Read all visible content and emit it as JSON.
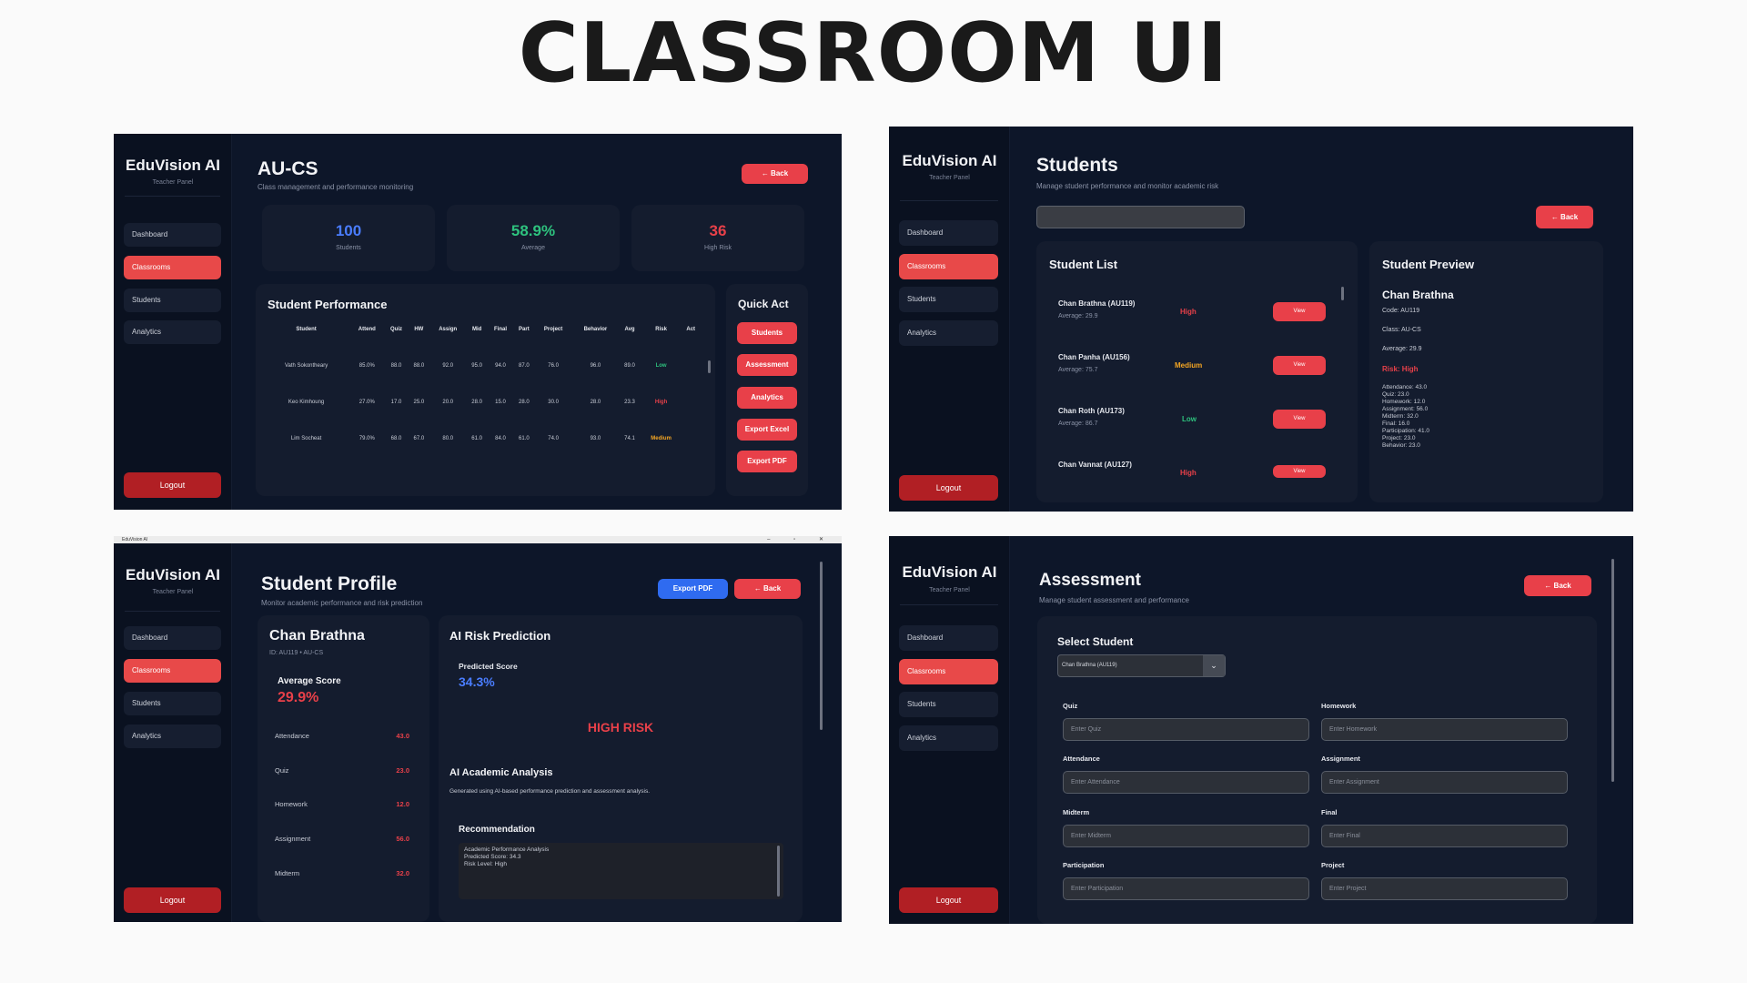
{
  "page_title": "CLASSROOM UI",
  "brand": "EduVision AI",
  "brand_sub": "Teacher Panel",
  "nav": [
    "Dashboard",
    "Classrooms",
    "Students",
    "Analytics"
  ],
  "logout": "Logout",
  "back": "← Back",
  "colors": {
    "accent": "#e84949",
    "green": "#2ec27e",
    "orange": "#f5a623",
    "blue": "#4a7dff",
    "risk_red": "#e84049"
  },
  "s1": {
    "title": "AU-CS",
    "subtitle": "Class management and performance monitoring",
    "stats": [
      {
        "value": "100",
        "label": "Students"
      },
      {
        "value": "58.9%",
        "label": "Average"
      },
      {
        "value": "36",
        "label": "High Risk"
      }
    ],
    "perf_title": "Student Performance",
    "headers": [
      "Student",
      "Attend",
      "Quiz",
      "HW",
      "Assign",
      "Mid",
      "Final",
      "Part",
      "Project",
      "Behavior",
      "Avg",
      "Risk",
      "Act"
    ],
    "rows": [
      [
        "Vath Sokontheary",
        "85.0%",
        "88.0",
        "88.0",
        "92.0",
        "95.0",
        "94.0",
        "87.0",
        "76.0",
        "96.0",
        "89.0",
        "Low",
        ""
      ],
      [
        "Keo Kimhoung",
        "27.0%",
        "17.0",
        "25.0",
        "20.0",
        "28.0",
        "15.0",
        "28.0",
        "30.0",
        "28.0",
        "23.3",
        "High",
        ""
      ],
      [
        "Lim Socheat",
        "79.0%",
        "68.0",
        "67.0",
        "80.0",
        "61.0",
        "84.0",
        "61.0",
        "74.0",
        "93.0",
        "74.1",
        "Medium",
        ""
      ]
    ],
    "quick_title": "Quick Act",
    "quick": [
      "Students",
      "Assessment",
      "Analytics",
      "Export Excel",
      "Export PDF"
    ]
  },
  "s2": {
    "title": "Students",
    "subtitle": "Manage student performance and monitor academic risk",
    "list_title": "Student List",
    "students": [
      {
        "name": "Chan Brathna (AU119)",
        "avg": "Average: 29.9",
        "risk": "High"
      },
      {
        "name": "Chan Panha (AU156)",
        "avg": "Average: 75.7",
        "risk": "Medium"
      },
      {
        "name": "Chan Roth (AU173)",
        "avg": "Average: 86.7",
        "risk": "Low"
      },
      {
        "name": "Chan Vannat (AU127)",
        "avg": "",
        "risk": "High"
      }
    ],
    "view": "View",
    "preview_title": "Student Preview",
    "preview": {
      "name": "Chan Brathna",
      "code": "Code: AU119",
      "class": "Class: AU-CS",
      "average": "Average: 29.9",
      "risk": "Risk: High",
      "details": [
        "Attendance: 43.0",
        "Quiz: 23.0",
        "Homework: 12.0",
        "Assignment: 56.0",
        "Midterm: 32.0",
        "Final: 16.0",
        "Participation: 41.0",
        "Project: 23.0",
        "Behavior: 23.0"
      ]
    }
  },
  "s3": {
    "window_title": "EduVision AI",
    "title": "Student Profile",
    "subtitle": "Monitor academic performance and risk prediction",
    "export_pdf": "Export PDF",
    "name": "Chan Brathna",
    "id": "ID: AU119 • AU-CS",
    "avg_label": "Average Score",
    "avg_value": "29.9%",
    "scores": [
      {
        "label": "Attendance",
        "value": "43.0"
      },
      {
        "label": "Quiz",
        "value": "23.0"
      },
      {
        "label": "Homework",
        "value": "12.0"
      },
      {
        "label": "Assignment",
        "value": "56.0"
      },
      {
        "label": "Midterm",
        "value": "32.0"
      }
    ],
    "ai_title": "AI Risk Prediction",
    "pred_label": "Predicted Score",
    "pred_value": "34.3%",
    "risk_banner": "HIGH RISK",
    "analysis_title": "AI Academic Analysis",
    "analysis_sub": "Generated using AI-based performance prediction and assessment analysis.",
    "rec_title": "Recommendation",
    "rec_lines": [
      "Academic Performance Analysis",
      "Predicted Score: 34.3",
      "Risk Level: High"
    ]
  },
  "s4": {
    "title": "Assessment",
    "subtitle": "Manage student assessment and performance",
    "select_title": "Select Student",
    "selected": "Chan Brathna (AU119)",
    "fields": [
      {
        "label": "Quiz",
        "placeholder": "Enter Quiz"
      },
      {
        "label": "Homework",
        "placeholder": "Enter Homework"
      },
      {
        "label": "Attendance",
        "placeholder": "Enter Attendance"
      },
      {
        "label": "Assignment",
        "placeholder": "Enter Assignment"
      },
      {
        "label": "Midterm",
        "placeholder": "Enter Midterm"
      },
      {
        "label": "Final",
        "placeholder": "Enter Final"
      },
      {
        "label": "Participation",
        "placeholder": "Enter Participation"
      },
      {
        "label": "Project",
        "placeholder": "Enter Project"
      }
    ]
  }
}
